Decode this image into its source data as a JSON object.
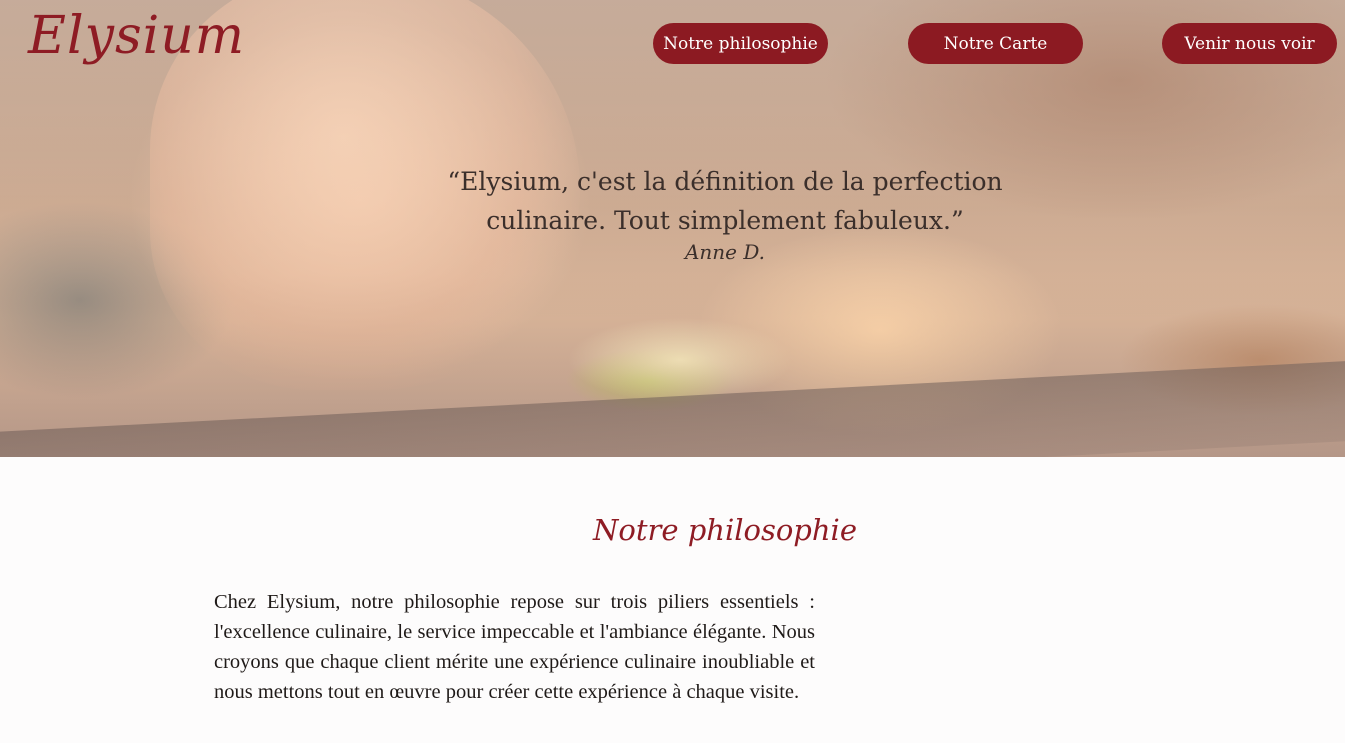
{
  "brand": {
    "logo_text": "Elysium",
    "accent_color": "#8c1a22"
  },
  "nav": {
    "items": [
      {
        "label": "Notre philosophie"
      },
      {
        "label": "Notre Carte"
      },
      {
        "label": "Venir nous voir"
      }
    ]
  },
  "hero": {
    "quote": "“Elysium, c'est la définition de la perfection culinaire. Tout simplement fabuleux.”",
    "author": "Anne D."
  },
  "philosophy": {
    "title": "Notre philosophie",
    "text": "Chez Elysium, notre philosophie repose sur trois piliers essentiels : l'excellence culinaire, le service impeccable et l'ambiance élégante. Nous croyons que chaque client mérite une expérience culinaire inoubliable et nous mettons tout en œuvre pour créer cette expérience à chaque visite."
  }
}
